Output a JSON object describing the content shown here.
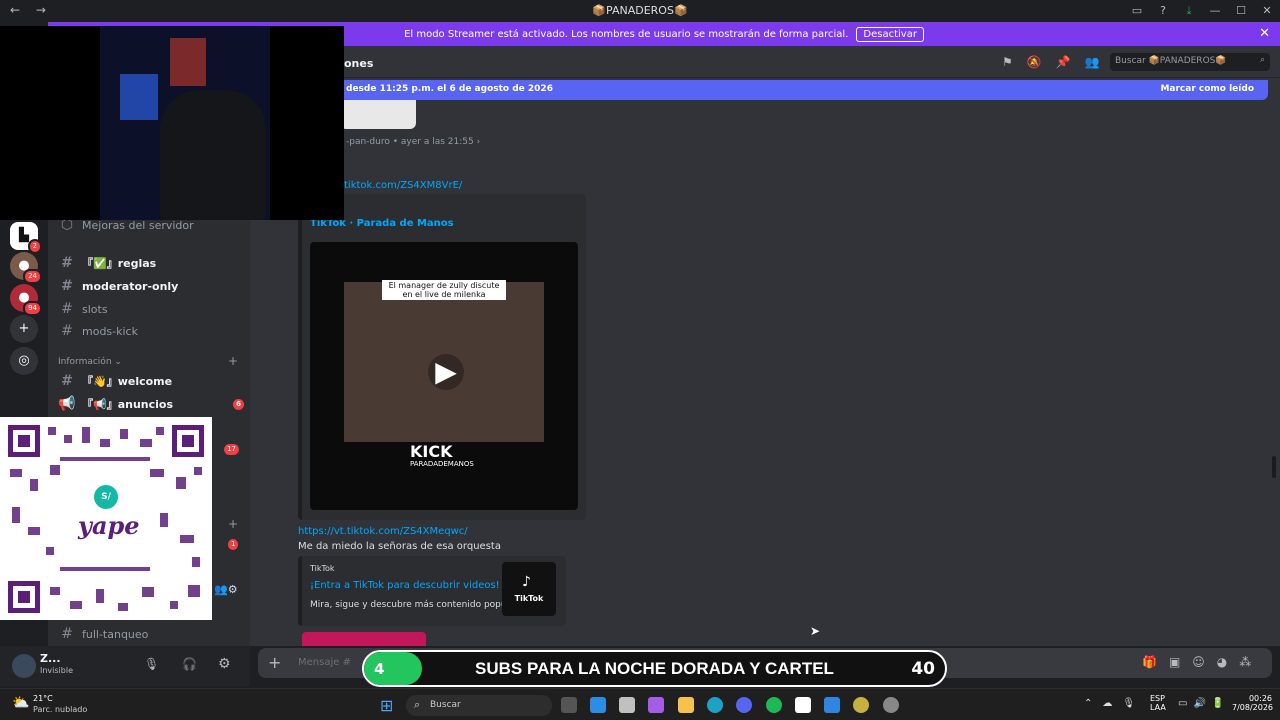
{
  "window": {
    "title": "📦PANADEROS📦"
  },
  "banner": {
    "text": "El modo Streamer está activado. Los nombres de usuario se mostrarán de forma parcial.",
    "button": "Desactivar"
  },
  "header": {
    "channel_partial": "ones",
    "search_placeholder": "Buscar 📦PANADEROS📦"
  },
  "new_messages": {
    "text": "desde 11:25 p.m. el 6 de agosto de 2026",
    "mark_read": "Marcar como leído"
  },
  "servers": [
    {
      "icon": "server-icon",
      "badge": "2"
    },
    {
      "icon": "server-avatar",
      "badge": "24"
    },
    {
      "icon": "server-avatar",
      "badge": "94"
    },
    {
      "icon": "add-server-icon",
      "badge": ""
    },
    {
      "icon": "explore-icon",
      "badge": ""
    }
  ],
  "channels": {
    "boost": "Mejoras del servidor",
    "items": [
      {
        "label": "『✅』reglas",
        "unread": true,
        "badge": ""
      },
      {
        "label": "moderator-only",
        "unread": true,
        "badge": ""
      },
      {
        "label": "slots",
        "unread": false,
        "badge": ""
      },
      {
        "label": "mods-kick",
        "unread": false,
        "badge": ""
      }
    ],
    "category": "Información",
    "info_items": [
      {
        "label": "『👋』welcome",
        "unread": true,
        "badge": ""
      },
      {
        "label": "『📢』anuncios",
        "unread": true,
        "badge": "6"
      }
    ],
    "hidden_badge_1": "17",
    "hidden_badge_2": "1",
    "bottom_item": "full-tanqueo"
  },
  "user": {
    "name": "Z...",
    "status": "Invisible"
  },
  "messages": {
    "author": "-pan-duro",
    "time": "ayer a las 21:55",
    "link1": "tiktok.com/ZS4XM8VrE/",
    "embed1_title": "TikTok · Parada de Manos",
    "video_caption": "El manager de zully discute en el live de milenka",
    "video_brand": "KICK",
    "video_handle": "PARADADEMANOS",
    "link2": "https://vt.tiktok.com/ZS4XMeqwc/",
    "text2": "Me da miedo la señoras de esa orquesta",
    "embed2_provider": "TikTok",
    "embed2_title": "¡Entra a TikTok para descubrir videos!",
    "embed2_desc": "Mira, sigue y descubre más contenido popular.",
    "embed2_thumb": "TikTok"
  },
  "composer": {
    "placeholder": "Mensaje #"
  },
  "overlay": {
    "subs_left": "4",
    "subs_text": "SUBS PARA LA NOCHE DORADA Y CARTEL",
    "subs_right": "40",
    "qr_brand": "yape",
    "qr_logo": "S/"
  },
  "taskbar": {
    "weather_temp": "21°C",
    "weather_desc": "Parc. nublado",
    "search": "Buscar",
    "lang1": "ESP",
    "lang2": "LAA",
    "time": "00:26",
    "date": "7/08/2026"
  },
  "colors": {
    "accent": "#5865f2",
    "banner": "#7c3aed",
    "link": "#00a8fc",
    "progress": "#22c55e"
  },
  "progress": {
    "subs_fraction": 0.1
  }
}
